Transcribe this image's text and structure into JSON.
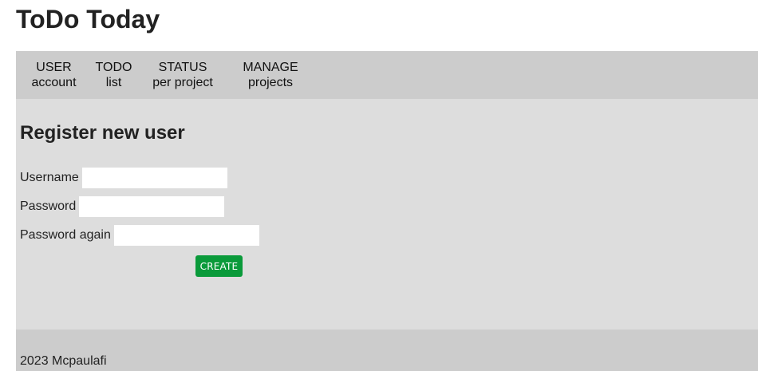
{
  "app": {
    "title": "ToDo Today"
  },
  "nav": {
    "items": [
      {
        "line1": "USER",
        "line2": "account"
      },
      {
        "line1": "TODO",
        "line2": "list"
      },
      {
        "line1": "STATUS",
        "line2": "per project"
      },
      {
        "line1": "MANAGE",
        "line2": "projects"
      }
    ]
  },
  "form": {
    "title": "Register new user",
    "username_label": "Username",
    "username_value": "",
    "password_label": "Password",
    "password_value": "",
    "password_again_label": "Password again",
    "password_again_value": "",
    "create_label": "CREATE"
  },
  "footer": {
    "text": "2023 Mcpaulafi"
  },
  "colors": {
    "nav_bg": "#cccccc",
    "main_bg": "#dddddd",
    "button_bg": "#0a9a3a",
    "button_text": "#ffffff"
  }
}
